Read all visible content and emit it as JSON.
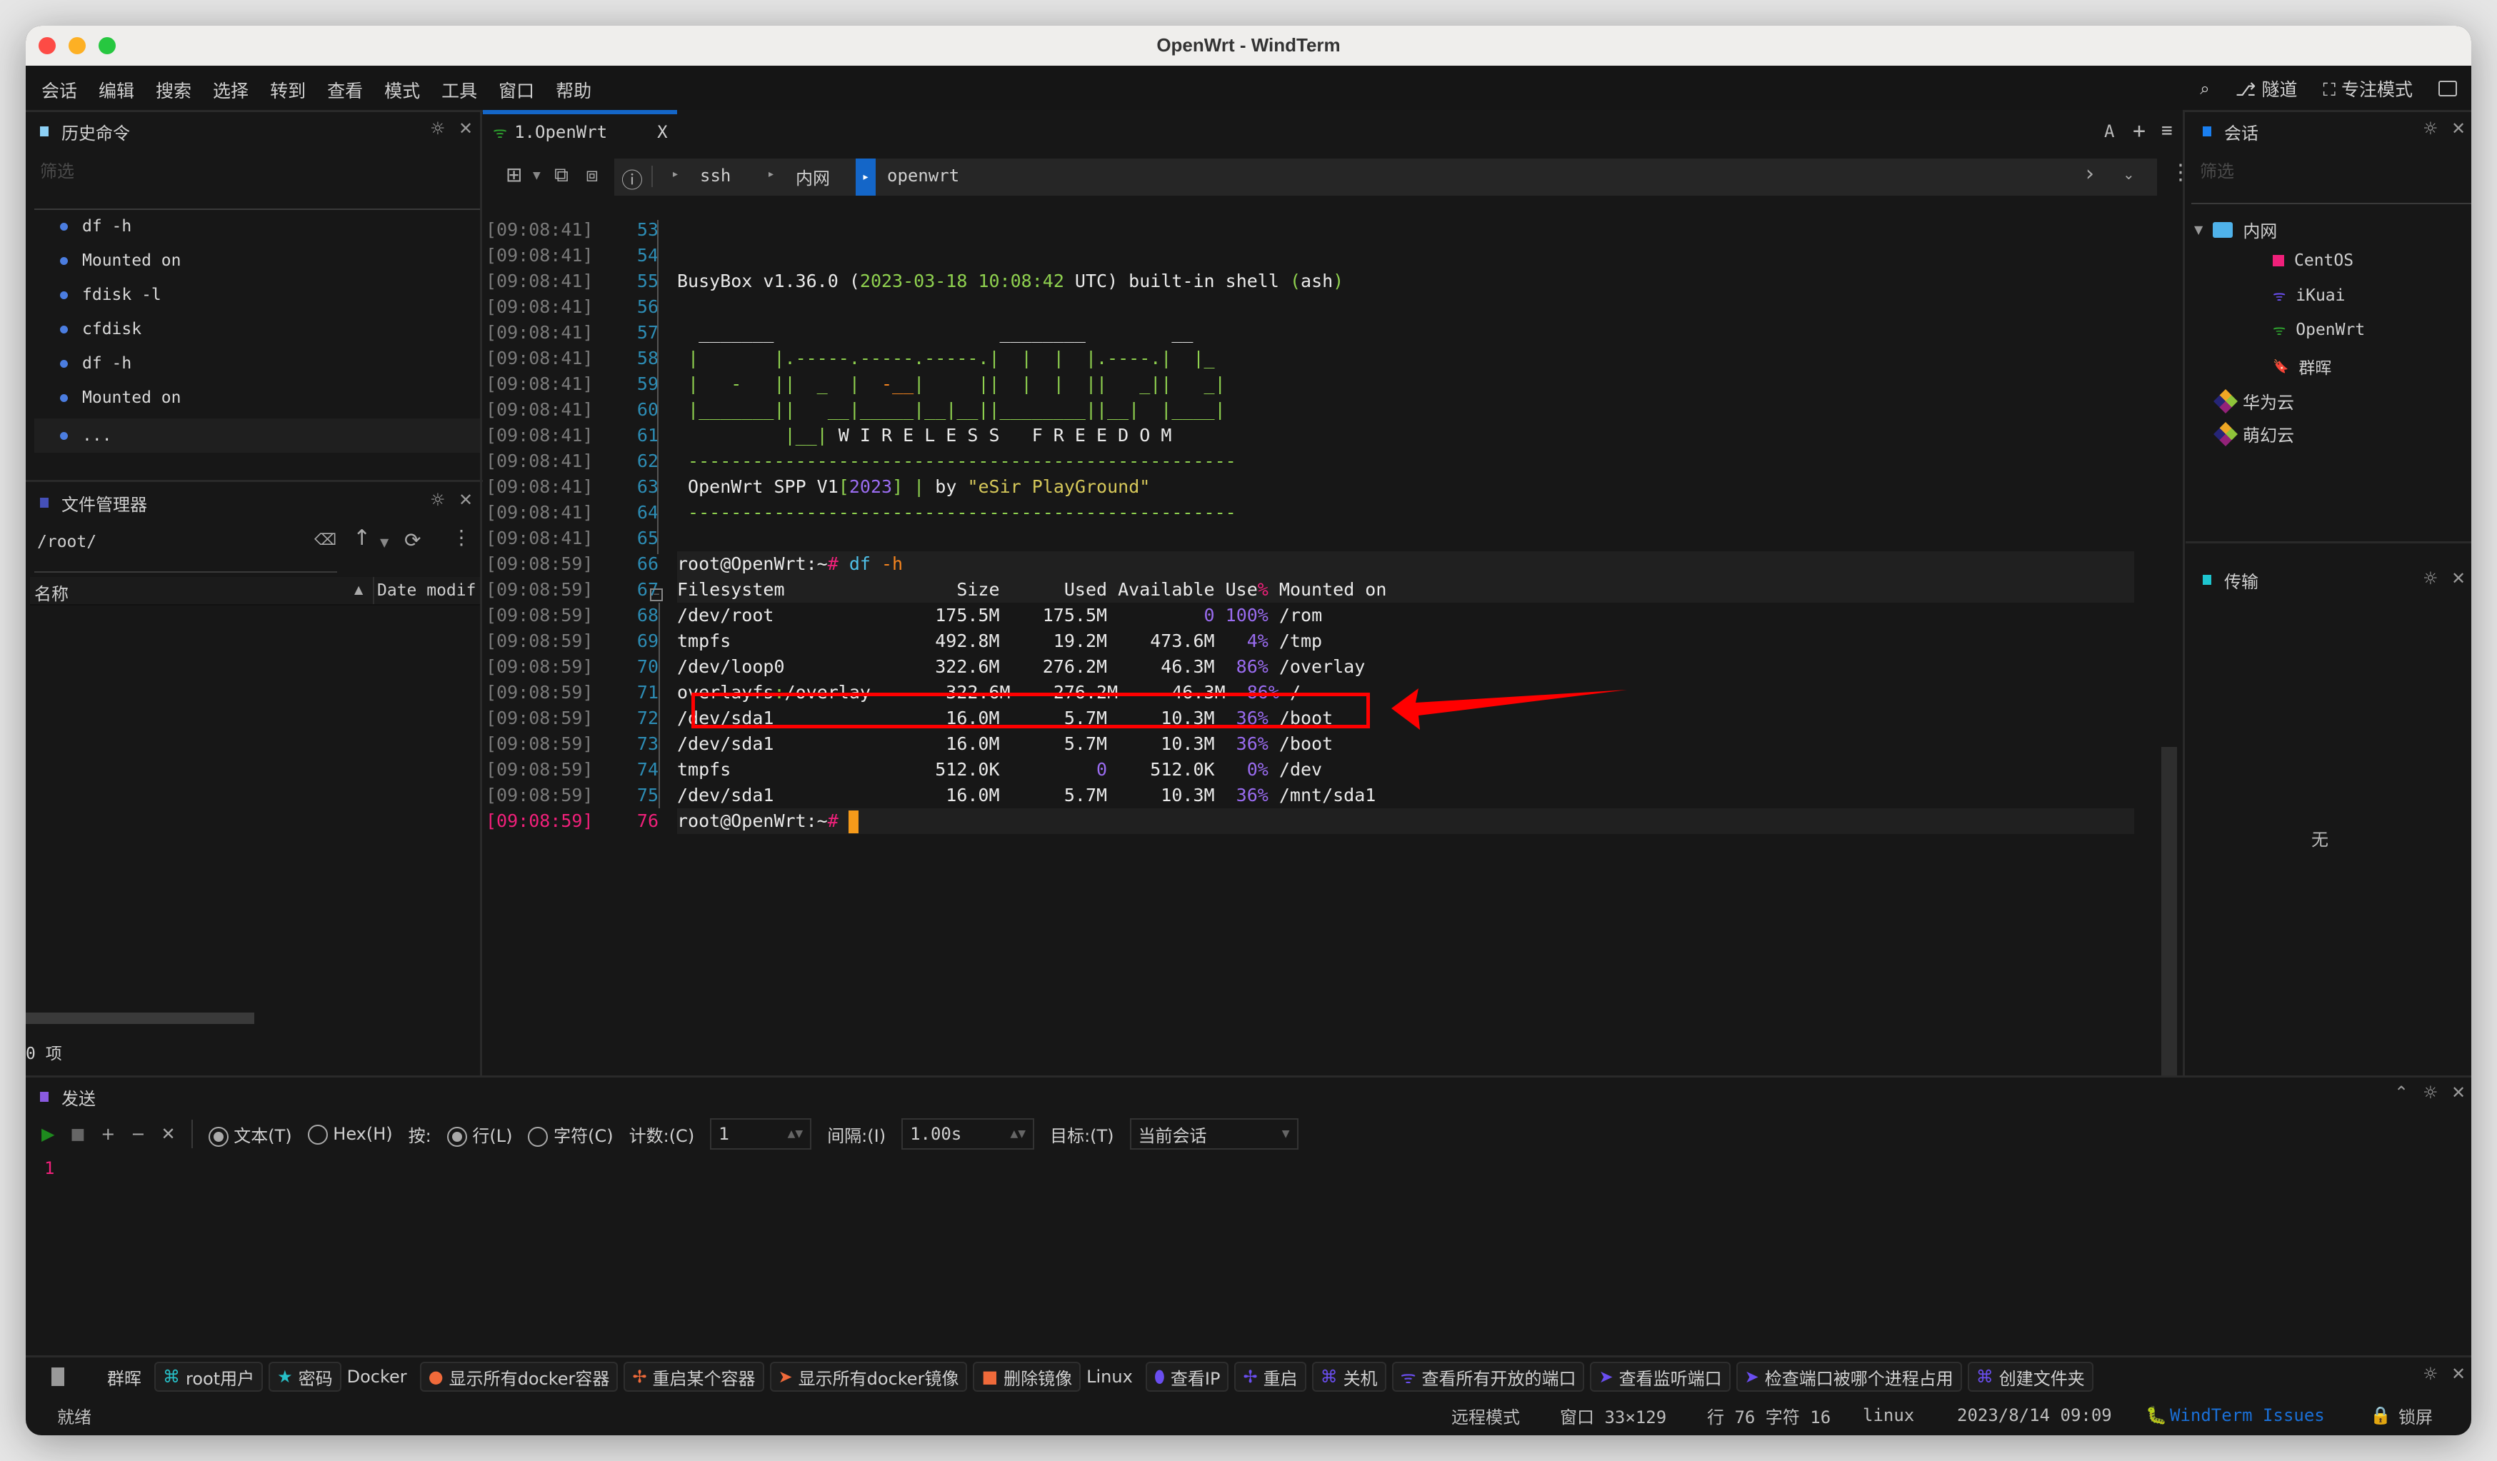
{
  "window": {
    "title": "OpenWrt - WindTerm"
  },
  "menu": [
    "会话",
    "编辑",
    "搜索",
    "选择",
    "转到",
    "查看",
    "模式",
    "工具",
    "窗口",
    "帮助"
  ],
  "menu_right": {
    "tunnel": "隧道",
    "focus_mode": "专注模式"
  },
  "history_panel": {
    "title": "历史命令",
    "filter_placeholder": "筛选",
    "items": [
      "df -h",
      "Mounted on",
      "fdisk -l",
      "cfdisk",
      "df -h",
      "Mounted on",
      "..."
    ]
  },
  "file_manager": {
    "title": "文件管理器",
    "path": "/root/",
    "col_name": "名称",
    "col_date": "Date modif",
    "count": "0 项"
  },
  "tab": {
    "label": "1.OpenWrt",
    "close": "X"
  },
  "breadcrumb": {
    "items": [
      "ssh",
      "内网",
      "openwrt"
    ]
  },
  "tab_actions": {
    "font": "A",
    "add": "+",
    "menu": "≡"
  },
  "terminal": {
    "lines": [
      {
        "ts": "[09:08:41]",
        "n": "53",
        "segs": []
      },
      {
        "ts": "[09:08:41]",
        "n": "54",
        "segs": []
      },
      {
        "ts": "[09:08:41]",
        "n": "55",
        "segs": [
          [
            "BusyBox v1.36.0 ",
            ""
          ],
          [
            "(",
            ""
          ],
          [
            "2023-03-18 10:08:42",
            "g"
          ],
          [
            " UTC) built-in shell ",
            ""
          ],
          [
            "(",
            "g"
          ],
          [
            "ash",
            ""
          ],
          [
            ")",
            "g"
          ]
        ]
      },
      {
        "ts": "[09:08:41]",
        "n": "56",
        "segs": []
      },
      {
        "ts": "[09:08:41]",
        "n": "57",
        "segs": [
          [
            "  _______                     ________        __",
            ""
          ]
        ]
      },
      {
        "ts": "[09:08:41]",
        "n": "58",
        "segs": [
          [
            " |       |.-----.-----.-----.|  |  |  |.----.|  |_",
            "g"
          ]
        ]
      },
      {
        "ts": "[09:08:41]",
        "n": "59",
        "segs": [
          [
            " |   -   ||  _  |  ",
            "g"
          ],
          [
            "-__",
            "o"
          ],
          [
            "|     ||  |  |  ||   _||   _|",
            "g"
          ]
        ]
      },
      {
        "ts": "[09:08:41]",
        "n": "60",
        "segs": [
          [
            " |_______||   __|_____|__|__||________||__|  |____|",
            "g"
          ]
        ]
      },
      {
        "ts": "[09:08:41]",
        "n": "61",
        "segs": [
          [
            "          ",
            "g"
          ],
          [
            "|__|",
            "g"
          ],
          [
            " W I R E L E S S   F R E E D O M",
            ""
          ]
        ]
      },
      {
        "ts": "[09:08:41]",
        "n": "62",
        "segs": [
          [
            " ---------------------------------------------------",
            "g"
          ]
        ]
      },
      {
        "ts": "[09:08:41]",
        "n": "63",
        "segs": [
          [
            " OpenWrt SPP V1",
            ""
          ],
          [
            "[",
            "g"
          ],
          [
            "2023",
            "p"
          ],
          [
            "]",
            "g"
          ],
          [
            " | ",
            "g"
          ],
          [
            "by ",
            ""
          ],
          [
            "\"eSir PlayGround\"",
            "yel"
          ]
        ]
      },
      {
        "ts": "[09:08:41]",
        "n": "64",
        "segs": [
          [
            " ---------------------------------------------------",
            "g"
          ]
        ]
      },
      {
        "ts": "[09:08:41]",
        "n": "65",
        "segs": []
      },
      {
        "ts": "[09:08:59]",
        "n": "66",
        "segs": [
          [
            "root@OpenWrt:~",
            ""
          ],
          [
            "#",
            "pk"
          ],
          [
            " df ",
            "c"
          ],
          [
            "-h",
            "o"
          ]
        ]
      },
      {
        "ts": "[09:08:59]",
        "n": "67",
        "segs": [
          [
            "Filesystem                Size      Used Available Use",
            ""
          ],
          [
            "%",
            "pk"
          ],
          [
            " Mounted on",
            ""
          ]
        ]
      },
      {
        "ts": "[09:08:59]",
        "n": "68",
        "segs": [
          [
            "/dev/root               175.5M    175.5M         ",
            ""
          ],
          [
            "0",
            "p"
          ],
          [
            " ",
            ""
          ],
          [
            "100%",
            "p"
          ],
          [
            " /rom",
            ""
          ]
        ]
      },
      {
        "ts": "[09:08:59]",
        "n": "69",
        "segs": [
          [
            "tmpfs                   492.8M     19.2M    473.6M   ",
            ""
          ],
          [
            "4%",
            "p"
          ],
          [
            " /tmp",
            ""
          ]
        ]
      },
      {
        "ts": "[09:08:59]",
        "n": "70",
        "segs": [
          [
            "/dev/loop0              322.6M    276.2M     46.3M  ",
            ""
          ],
          [
            "86%",
            "p"
          ],
          [
            " /overlay",
            ""
          ]
        ]
      },
      {
        "ts": "[09:08:59]",
        "n": "71",
        "segs": [
          [
            "overlayfs",
            ""
          ],
          [
            ":",
            "g"
          ],
          [
            "/overlay       322.6M    276.2M     46.3M  ",
            ""
          ],
          [
            "86%",
            "p"
          ],
          [
            " /",
            ""
          ]
        ]
      },
      {
        "ts": "[09:08:59]",
        "n": "72",
        "segs": [
          [
            "/dev/sda1                16.0M      5.7M     10.3M  ",
            ""
          ],
          [
            "36%",
            "p"
          ],
          [
            " /boot",
            ""
          ]
        ]
      },
      {
        "ts": "[09:08:59]",
        "n": "73",
        "segs": [
          [
            "/dev/sda1                16.0M      5.7M     10.3M  ",
            ""
          ],
          [
            "36%",
            "p"
          ],
          [
            " /boot",
            ""
          ]
        ]
      },
      {
        "ts": "[09:08:59]",
        "n": "74",
        "segs": [
          [
            "tmpfs                   512.0K         ",
            ""
          ],
          [
            "0",
            "p"
          ],
          [
            "    512.0K   ",
            ""
          ],
          [
            "0%",
            "p"
          ],
          [
            " /dev",
            ""
          ]
        ]
      },
      {
        "ts": "[09:08:59]",
        "n": "75",
        "segs": [
          [
            "/dev/sda1                16.0M      5.7M     10.3M  ",
            ""
          ],
          [
            "36%",
            "p"
          ],
          [
            " /mnt/sda1",
            ""
          ]
        ]
      },
      {
        "ts": "[09:08:59]",
        "n": "76",
        "segs": [
          [
            "root@OpenWrt:~",
            ""
          ],
          [
            "#",
            "pk"
          ]
        ]
      }
    ],
    "highlighted_line": "71"
  },
  "sessions_panel": {
    "title": "会话",
    "filter_placeholder": "筛选",
    "folder": "内网",
    "children": [
      {
        "label": "CentOS",
        "icon": "square",
        "color": "#f0207a"
      },
      {
        "label": "iKuai",
        "icon": "wifi",
        "color": "#6a4ef0"
      },
      {
        "label": "OpenWrt",
        "icon": "wifi",
        "color": "#2ea02e"
      },
      {
        "label": "群晖",
        "icon": "bookmark",
        "color": "#2a7cf0"
      }
    ],
    "roots": [
      "华为云",
      "萌幻云"
    ]
  },
  "transfer_panel": {
    "title": "传输",
    "empty": "无"
  },
  "send_panel": {
    "title": "发送",
    "mode_text": "文本(T)",
    "mode_hex": "Hex(H)",
    "by_label": "按:",
    "by_line": "行(L)",
    "by_char": "字符(C)",
    "count_label": "计数:(C)",
    "count_value": "1",
    "interval_label": "间隔:(I)",
    "interval_value": "1.00s",
    "target_label": "目标:(T)",
    "target_value": "当前会话",
    "editor_line": "1"
  },
  "quick_toolbar": [
    {
      "type": "plain",
      "label": "群晖"
    },
    {
      "type": "btn",
      "label": "root用户",
      "icon": "⌘",
      "color": "#27c0c8"
    },
    {
      "type": "btn",
      "label": "密码",
      "icon": "★",
      "color": "#27c0c8"
    },
    {
      "type": "plain",
      "label": "Docker"
    },
    {
      "type": "btn",
      "label": "显示所有docker容器",
      "icon": "●",
      "color": "#f06a3a"
    },
    {
      "type": "btn",
      "label": "重启某个容器",
      "icon": "✢",
      "color": "#f06a3a"
    },
    {
      "type": "btn",
      "label": "显示所有docker镜像",
      "icon": "➤",
      "color": "#f06a3a"
    },
    {
      "type": "btn",
      "label": "删除镜像",
      "icon": "■",
      "color": "#f06a3a"
    },
    {
      "type": "plain",
      "label": "Linux"
    },
    {
      "type": "btn",
      "label": "查看IP",
      "icon": "⬮",
      "color": "#6a4ef0"
    },
    {
      "type": "btn",
      "label": "重启",
      "icon": "✢",
      "color": "#6a4ef0"
    },
    {
      "type": "btn",
      "label": "关机",
      "icon": "⌘",
      "color": "#6a4ef0"
    },
    {
      "type": "btn",
      "label": "查看所有开放的端口",
      "icon": "ᯤ",
      "color": "#6a4ef0"
    },
    {
      "type": "btn",
      "label": "查看监听端口",
      "icon": "➤",
      "color": "#6a4ef0"
    },
    {
      "type": "btn",
      "label": "检查端口被哪个进程占用",
      "icon": "➤",
      "color": "#6a4ef0"
    },
    {
      "type": "btn",
      "label": "创建文件夹",
      "icon": "⌘",
      "color": "#6a4ef0"
    }
  ],
  "statusbar": {
    "ready": "就绪",
    "mode": "远程模式",
    "window": "窗口 33×129",
    "position": "行 76 字符 16",
    "os": "linux",
    "datetime": "2023/8/14 09:09",
    "issues_link": "WindTerm Issues",
    "lock": "锁屏"
  }
}
